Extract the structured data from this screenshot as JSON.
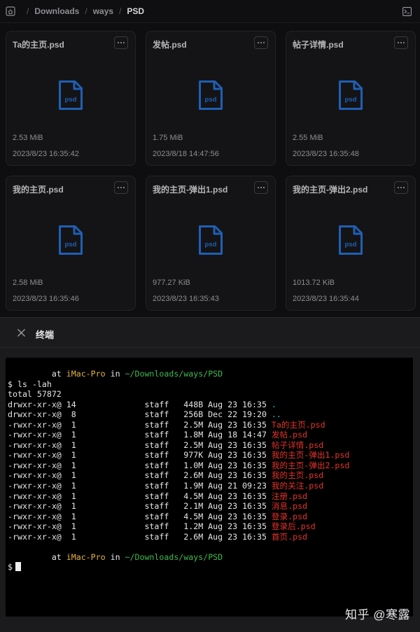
{
  "breadcrumb": {
    "items": [
      "Downloads",
      "ways",
      "PSD"
    ]
  },
  "files": [
    {
      "name": "Ta的主页.psd",
      "size": "2.53 MiB",
      "date": "2023/8/23 16:35:42",
      "type": "psd"
    },
    {
      "name": "发帖.psd",
      "size": "1.75 MiB",
      "date": "2023/8/18 14:47:56",
      "type": "psd"
    },
    {
      "name": "帖子详情.psd",
      "size": "2.55 MiB",
      "date": "2023/8/23 16:35:48",
      "type": "psd"
    },
    {
      "name": "我的主页.psd",
      "size": "2.58 MiB",
      "date": "2023/8/23 16:35:46",
      "type": "psd"
    },
    {
      "name": "我的主页-弹出1.psd",
      "size": "977.27 KiB",
      "date": "2023/8/23 16:35:43",
      "type": "psd"
    },
    {
      "name": "我的主页-弹出2.psd",
      "size": "1013.72 KiB",
      "date": "2023/8/23 16:35:44",
      "type": "psd"
    }
  ],
  "terminal": {
    "title": "终端",
    "prompt": {
      "pre": "         at ",
      "host": "iMac-Pro",
      "mid": " in ",
      "path": "~/Downloads/ways/PSD"
    },
    "command": "$ ls -lah",
    "total": "total 57872",
    "rows": [
      {
        "text": "drwxr-xr-x@ 14              staff   448B Aug 23 16:35 ",
        "name": ".",
        "kind": "dir"
      },
      {
        "text": "drwxr-xr-x@  8              staff   256B Dec 22 19:20 ",
        "name": "..",
        "kind": "dir"
      },
      {
        "text": "-rwxr-xr-x@  1              staff   2.5M Aug 23 16:35 ",
        "name": "Ta的主页.psd",
        "kind": "file"
      },
      {
        "text": "-rwxr-xr-x@  1              staff   1.8M Aug 18 14:47 ",
        "name": "发帖.psd",
        "kind": "file"
      },
      {
        "text": "-rwxr-xr-x@  1              staff   2.5M Aug 23 16:35 ",
        "name": "帖子详情.psd",
        "kind": "file"
      },
      {
        "text": "-rwxr-xr-x@  1              staff   977K Aug 23 16:35 ",
        "name": "我的主页-弹出1.psd",
        "kind": "file"
      },
      {
        "text": "-rwxr-xr-x@  1              staff   1.0M Aug 23 16:35 ",
        "name": "我的主页-弹出2.psd",
        "kind": "file"
      },
      {
        "text": "-rwxr-xr-x@  1              staff   2.6M Aug 23 16:35 ",
        "name": "我的主页.psd",
        "kind": "file"
      },
      {
        "text": "-rwxr-xr-x@  1              staff   1.9M Aug 21 09:23 ",
        "name": "我的关注.psd",
        "kind": "file"
      },
      {
        "text": "-rwxr-xr-x@  1              staff   4.5M Aug 23 16:35 ",
        "name": "注册.psd",
        "kind": "file"
      },
      {
        "text": "-rwxr-xr-x@  1              staff   2.1M Aug 23 16:35 ",
        "name": "消息.psd",
        "kind": "file"
      },
      {
        "text": "-rwxr-xr-x@  1              staff   4.5M Aug 23 16:35 ",
        "name": "登录.psd",
        "kind": "file"
      },
      {
        "text": "-rwxr-xr-x@  1              staff   1.2M Aug 23 16:35 ",
        "name": "登录后.psd",
        "kind": "file"
      },
      {
        "text": "-rwxr-xr-x@  1              staff   2.6M Aug 23 16:35 ",
        "name": "首页.psd",
        "kind": "file"
      }
    ],
    "input_prompt": "$"
  },
  "watermark": "知乎 @寒露",
  "colors": {
    "background": "#0e0e10",
    "card": "#141416",
    "psd_icon": "#1f5fb4",
    "prompt_host": "#e3b341",
    "prompt_path": "#3fb950",
    "file_name": "#e5332a",
    "dir_name": "#39c5cf"
  },
  "icons": {
    "home": "home-icon",
    "terminal_toggle": "terminal-icon",
    "card_menu": "more-icon",
    "file": "psd-file-icon",
    "close": "close-icon"
  }
}
